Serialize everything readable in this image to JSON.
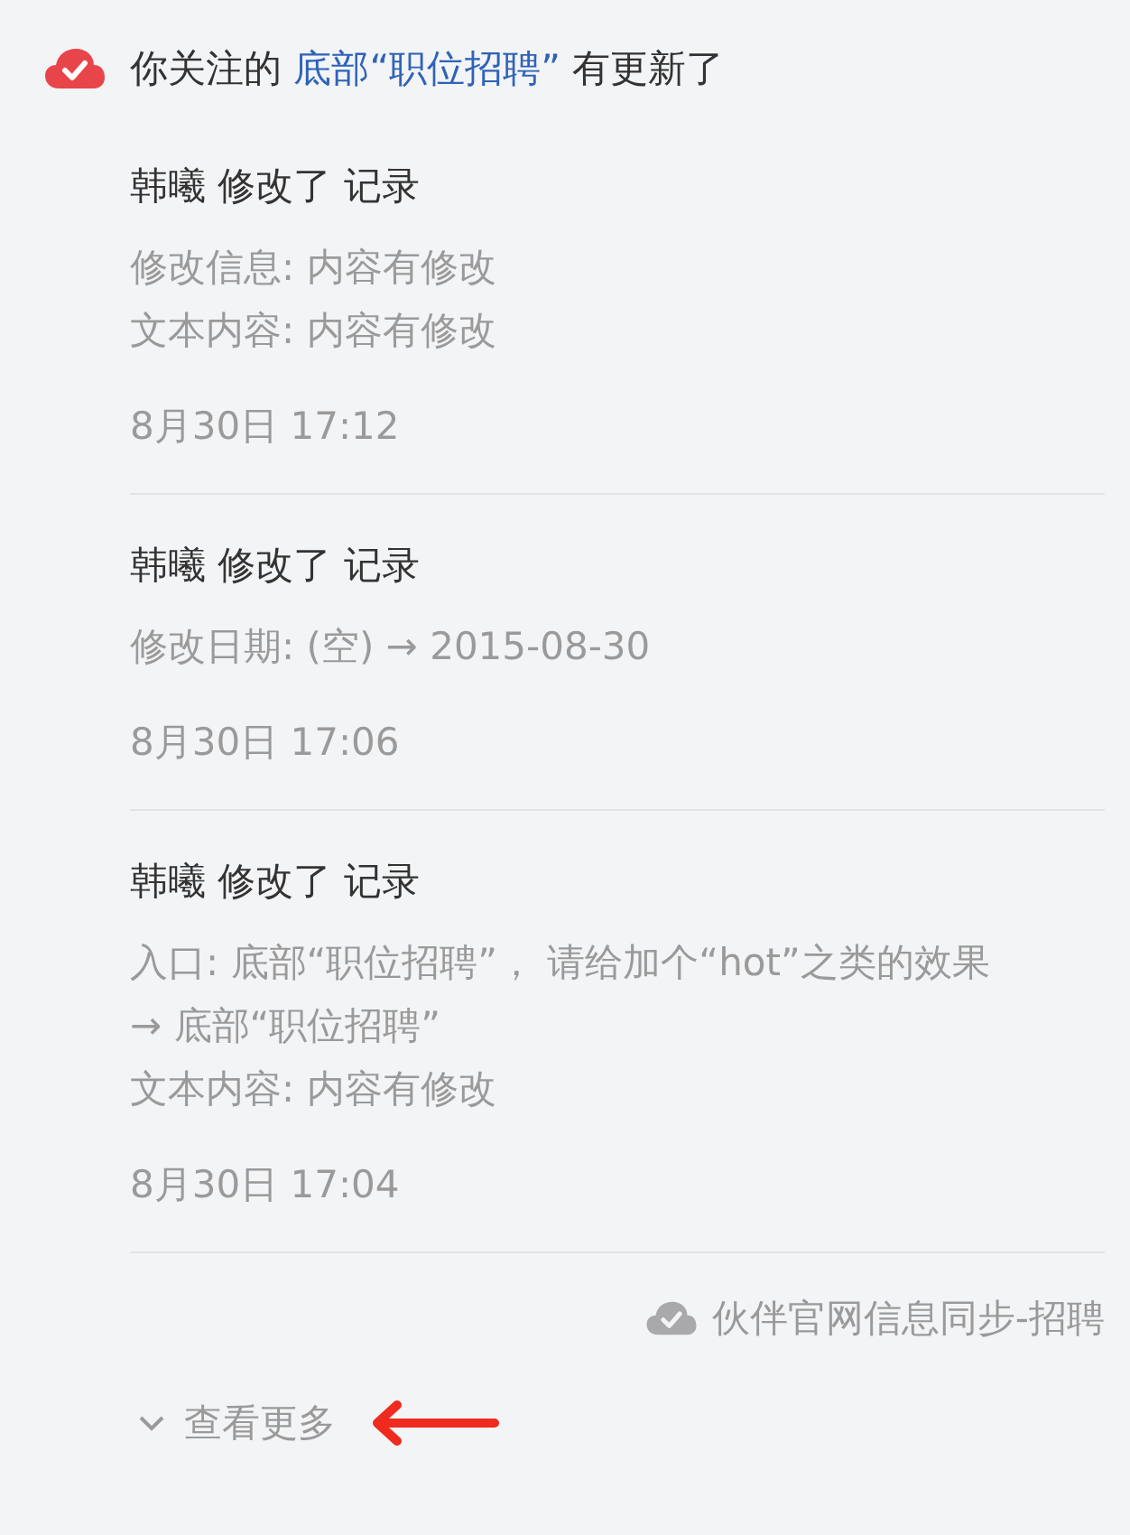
{
  "notification": {
    "text_before": "你关注的",
    "link": "底部“职位招聘”",
    "text_after": "有更新了"
  },
  "entries": [
    {
      "title": "韩曦 修改了 记录",
      "details": [
        "修改信息: 内容有修改",
        "文本内容: 内容有修改"
      ],
      "time": "8月30日 17:12"
    },
    {
      "title": "韩曦 修改了 记录",
      "details": [
        "修改日期: (空) → 2015-08-30"
      ],
      "time": "8月30日 17:06"
    },
    {
      "title": "韩曦 修改了 记录",
      "details": [
        "入口: 底部“职位招聘”， 请给加个“hot”之类的效果",
        "→ 底部“职位招聘”",
        "文本内容: 内容有修改"
      ],
      "time": "8月30日 17:04"
    }
  ],
  "source": "伙伴官网信息同步-招聘",
  "more_link": "查看更多"
}
